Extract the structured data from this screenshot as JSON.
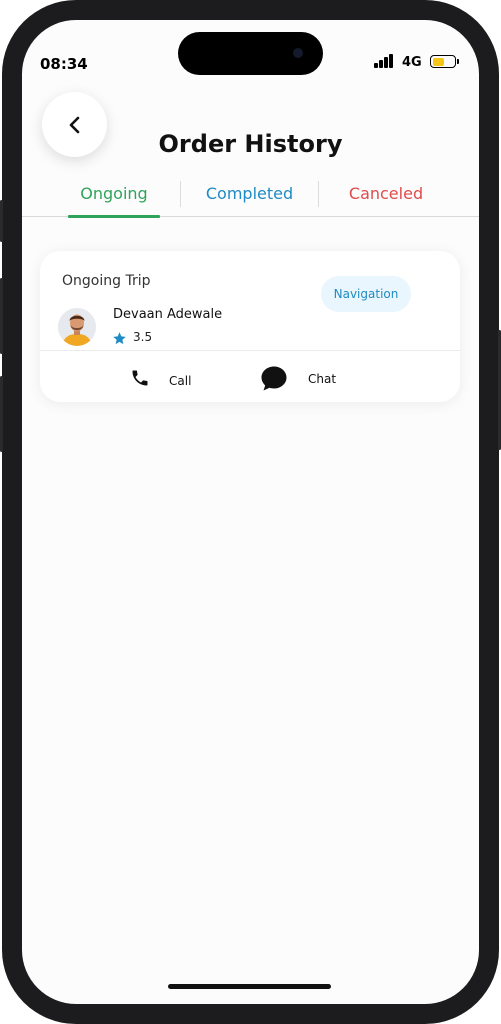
{
  "status_bar": {
    "time": "08:34",
    "network": "4G",
    "battery_level": 0.55,
    "battery_color": "#f5c518"
  },
  "header": {
    "title": "Order History",
    "back_icon": "chevron-left-icon"
  },
  "tabs": [
    {
      "label": "Ongoing",
      "active": true,
      "color": "#2fa35a"
    },
    {
      "label": "Completed",
      "active": false,
      "color": "#1f8bc4"
    },
    {
      "label": "Canceled",
      "active": false,
      "color": "#e04b4b"
    }
  ],
  "trip_card": {
    "heading": "Ongoing Trip",
    "navigation_label": "Navigation",
    "driver": {
      "name": "Devaan Adewale",
      "rating": "3.5"
    },
    "actions": {
      "call_label": "Call",
      "chat_label": "Chat"
    }
  },
  "colors": {
    "star": "#1f8bc4"
  }
}
